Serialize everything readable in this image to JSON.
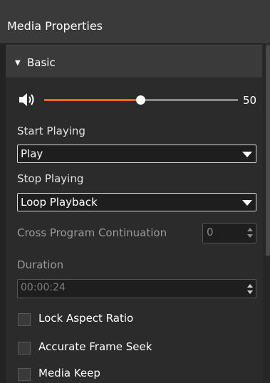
{
  "panel": {
    "title": "Media Properties"
  },
  "section": {
    "title": "Basic",
    "expanded": true
  },
  "volume": {
    "value": 50,
    "value_label": "50",
    "accent_color": "#f26a16"
  },
  "start_playing": {
    "label": "Start Playing",
    "selected": "Play"
  },
  "stop_playing": {
    "label": "Stop Playing",
    "selected": "Loop Playback"
  },
  "cross_program": {
    "label": "Cross Program Continuation",
    "value": "0"
  },
  "duration": {
    "label": "Duration",
    "value": "00:00:24"
  },
  "options": [
    {
      "label": "Lock Aspect Ratio",
      "checked": false
    },
    {
      "label": "Accurate Frame Seek",
      "checked": false
    },
    {
      "label": "Media Keep",
      "checked": false
    }
  ]
}
